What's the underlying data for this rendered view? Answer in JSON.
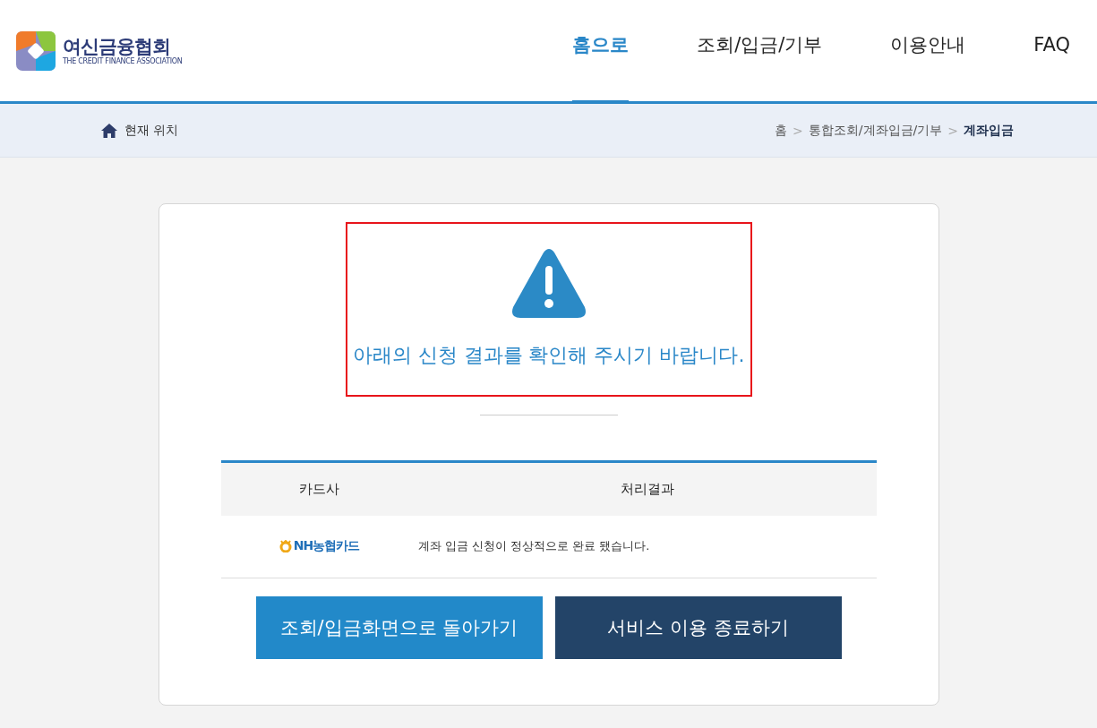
{
  "logo": {
    "name": "여신금융협회",
    "subtitle": "THE CREDIT FINANCE ASSOCIATION"
  },
  "nav": [
    {
      "label": "홈으로",
      "selected": true
    },
    {
      "label": "조회/입금/기부",
      "selected": false
    },
    {
      "label": "이용안내",
      "selected": false
    },
    {
      "label": "FAQ",
      "selected": false
    }
  ],
  "location": {
    "label": "현재 위치",
    "breadcrumb": [
      {
        "label": "홈",
        "current": false
      },
      {
        "label": ">",
        "kind": "sep"
      },
      {
        "label": "통합조회/계좌입금/기부",
        "current": false
      },
      {
        "label": ">",
        "kind": "sep"
      },
      {
        "label": "계좌입금",
        "current": true
      }
    ]
  },
  "notice": {
    "message": "아래의 신청 결과를 확인해 주시기 바랍니다.",
    "highlighted": true
  },
  "table": {
    "columns": [
      "카드사",
      "처리결과"
    ],
    "rows": [
      {
        "card": "NH농협카드",
        "result": "계좌 입금 신청이 정상적으로 완료 됐습니다."
      }
    ]
  },
  "buttons": [
    {
      "label": "조회/입금화면으로 돌아가기",
      "kind": "primary"
    },
    {
      "label": "서비스 이용 종료하기",
      "kind": "dark"
    }
  ]
}
